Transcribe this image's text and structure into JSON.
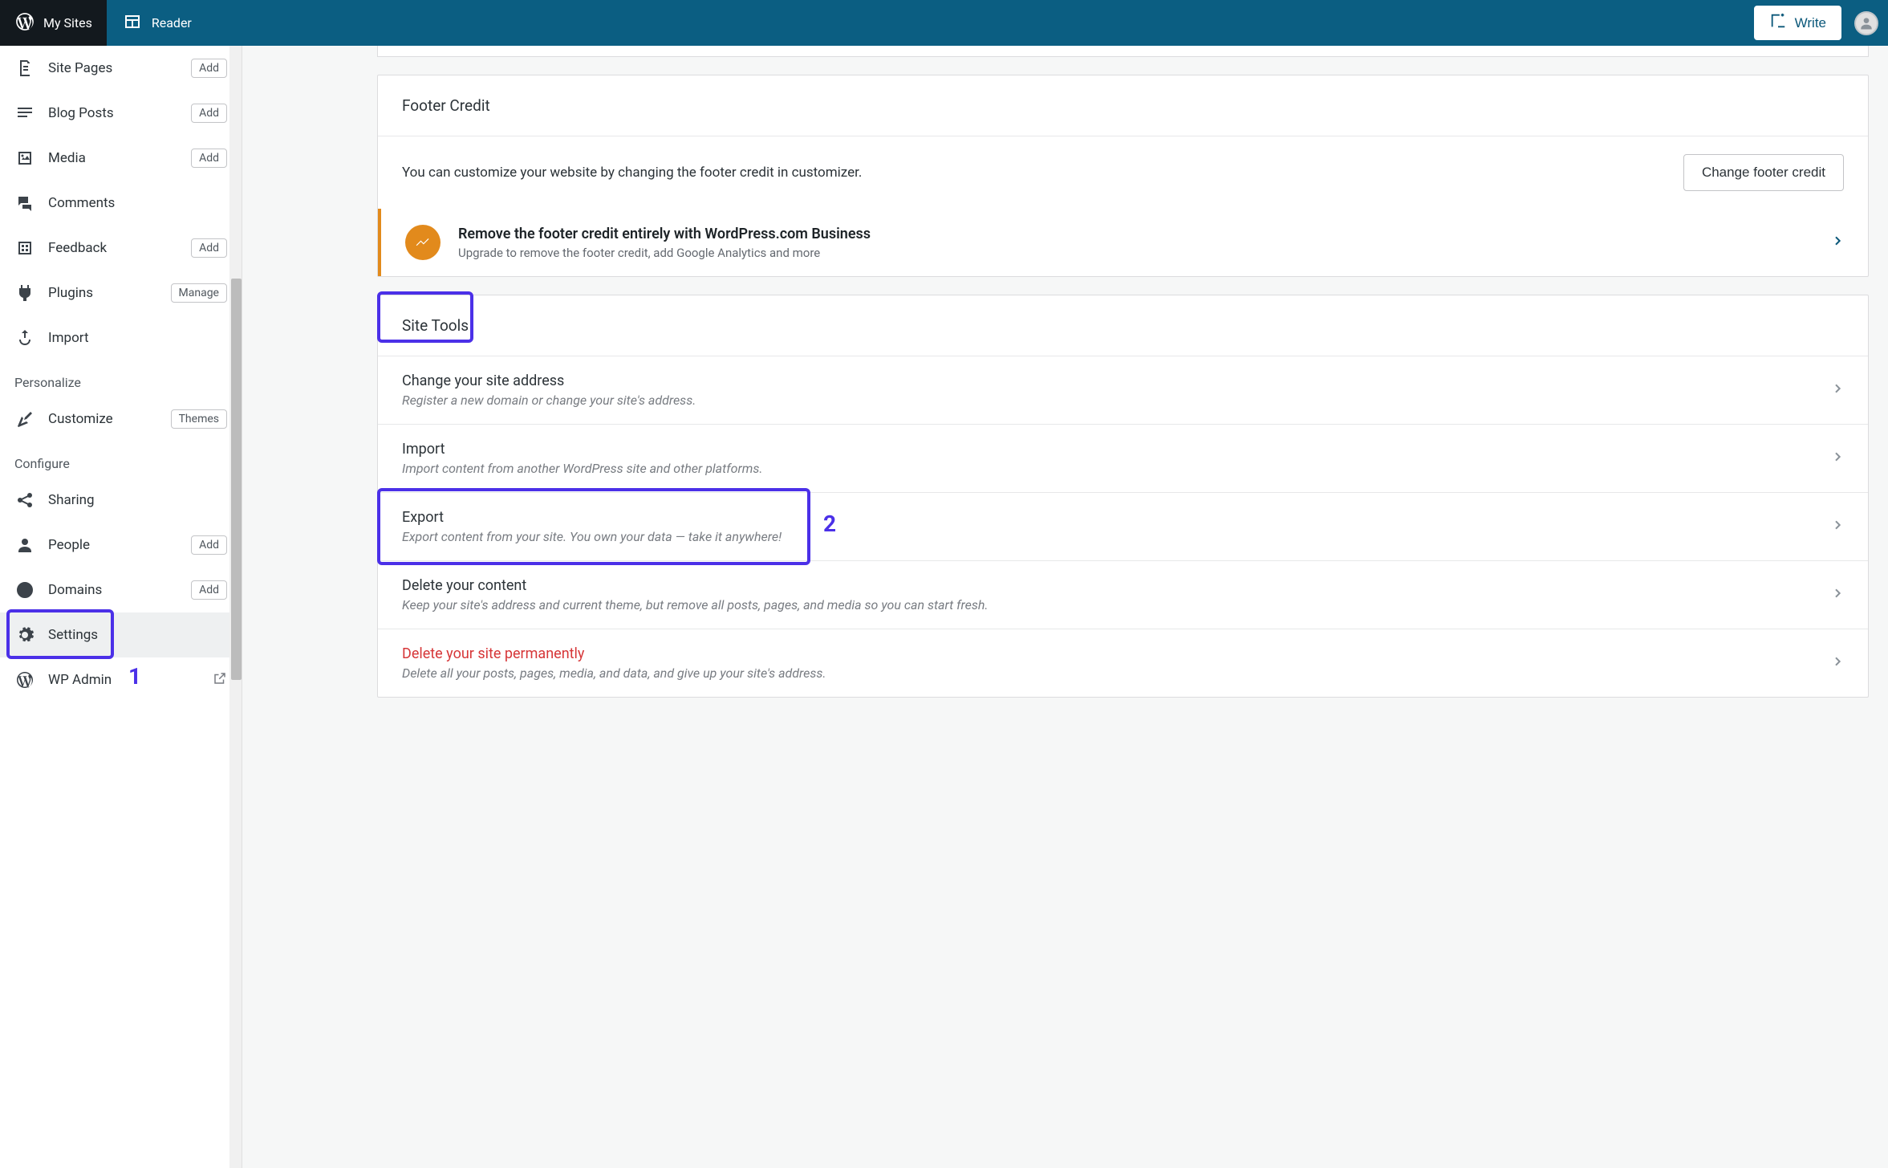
{
  "topbar": {
    "mysites": "My Sites",
    "reader": "Reader",
    "write": "Write"
  },
  "sidebar": {
    "items": [
      {
        "label": "Site Pages",
        "pill": "Add"
      },
      {
        "label": "Blog Posts",
        "pill": "Add"
      },
      {
        "label": "Media",
        "pill": "Add"
      },
      {
        "label": "Comments",
        "pill": null
      },
      {
        "label": "Feedback",
        "pill": "Add"
      },
      {
        "label": "Plugins",
        "pill": "Manage"
      },
      {
        "label": "Import",
        "pill": null
      }
    ],
    "personalize_header": "Personalize",
    "personalize": [
      {
        "label": "Customize",
        "pill": "Themes"
      }
    ],
    "configure_header": "Configure",
    "configure": [
      {
        "label": "Sharing",
        "pill": null
      },
      {
        "label": "People",
        "pill": "Add"
      },
      {
        "label": "Domains",
        "pill": "Add"
      },
      {
        "label": "Settings",
        "pill": null
      },
      {
        "label": "WP Admin",
        "pill": null
      }
    ]
  },
  "annotations": {
    "one": "1",
    "two": "2"
  },
  "footer_credit": {
    "header": "Footer Credit",
    "text": "You can customize your website by changing the footer credit in customizer.",
    "button": "Change footer credit"
  },
  "upsell": {
    "title": "Remove the footer credit entirely with WordPress.com Business",
    "sub": "Upgrade to remove the footer credit, add Google Analytics and more"
  },
  "site_tools": {
    "header": "Site Tools",
    "rows": [
      {
        "title": "Change your site address",
        "sub": "Register a new domain or change your site's address."
      },
      {
        "title": "Import",
        "sub": "Import content from another WordPress site and other platforms."
      },
      {
        "title": "Export",
        "sub": "Export content from your site. You own your data — take it anywhere!"
      },
      {
        "title": "Delete your content",
        "sub": "Keep your site's address and current theme, but remove all posts, pages, and media so you can start fresh."
      },
      {
        "title": "Delete your site permanently",
        "sub": "Delete all your posts, pages, media, and data, and give up your site's address.",
        "danger": true
      }
    ]
  }
}
